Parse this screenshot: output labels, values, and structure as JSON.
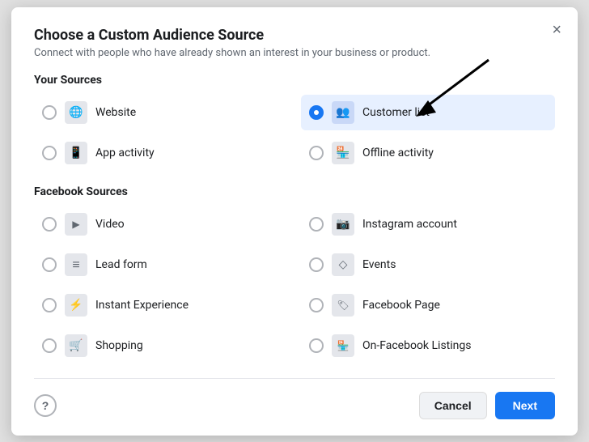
{
  "dialog": {
    "title": "Choose a Custom Audience Source",
    "subtitle": "Connect with people who have already shown an interest in your business or product.",
    "close_label": "×"
  },
  "sections": [
    {
      "id": "your-sources",
      "label": "Your Sources",
      "options": [
        {
          "id": "website",
          "label": "Website",
          "icon": "🌐",
          "selected": false,
          "col": 1
        },
        {
          "id": "customer-list",
          "label": "Customer list",
          "icon": "👥",
          "selected": true,
          "col": 2
        },
        {
          "id": "app-activity",
          "label": "App activity",
          "icon": "📱",
          "selected": false,
          "col": 1
        },
        {
          "id": "offline-activity",
          "label": "Offline activity",
          "icon": "🏪",
          "selected": false,
          "col": 2
        }
      ]
    },
    {
      "id": "facebook-sources",
      "label": "Facebook Sources",
      "options": [
        {
          "id": "video",
          "label": "Video",
          "icon": "▶",
          "selected": false,
          "col": 1
        },
        {
          "id": "instagram-account",
          "label": "Instagram account",
          "icon": "📷",
          "selected": false,
          "col": 2
        },
        {
          "id": "lead-form",
          "label": "Lead form",
          "icon": "≡",
          "selected": false,
          "col": 1
        },
        {
          "id": "events",
          "label": "Events",
          "icon": "◇",
          "selected": false,
          "col": 2
        },
        {
          "id": "instant-experience",
          "label": "Instant Experience",
          "icon": "⚡",
          "selected": false,
          "col": 1
        },
        {
          "id": "facebook-page",
          "label": "Facebook Page",
          "icon": "🏷",
          "selected": false,
          "col": 2
        },
        {
          "id": "shopping",
          "label": "Shopping",
          "icon": "🛒",
          "selected": false,
          "col": 1
        },
        {
          "id": "on-facebook-listings",
          "label": "On-Facebook Listings",
          "icon": "🏷",
          "selected": false,
          "col": 2
        }
      ]
    }
  ],
  "footer": {
    "help_icon": "?",
    "cancel_label": "Cancel",
    "next_label": "Next"
  }
}
